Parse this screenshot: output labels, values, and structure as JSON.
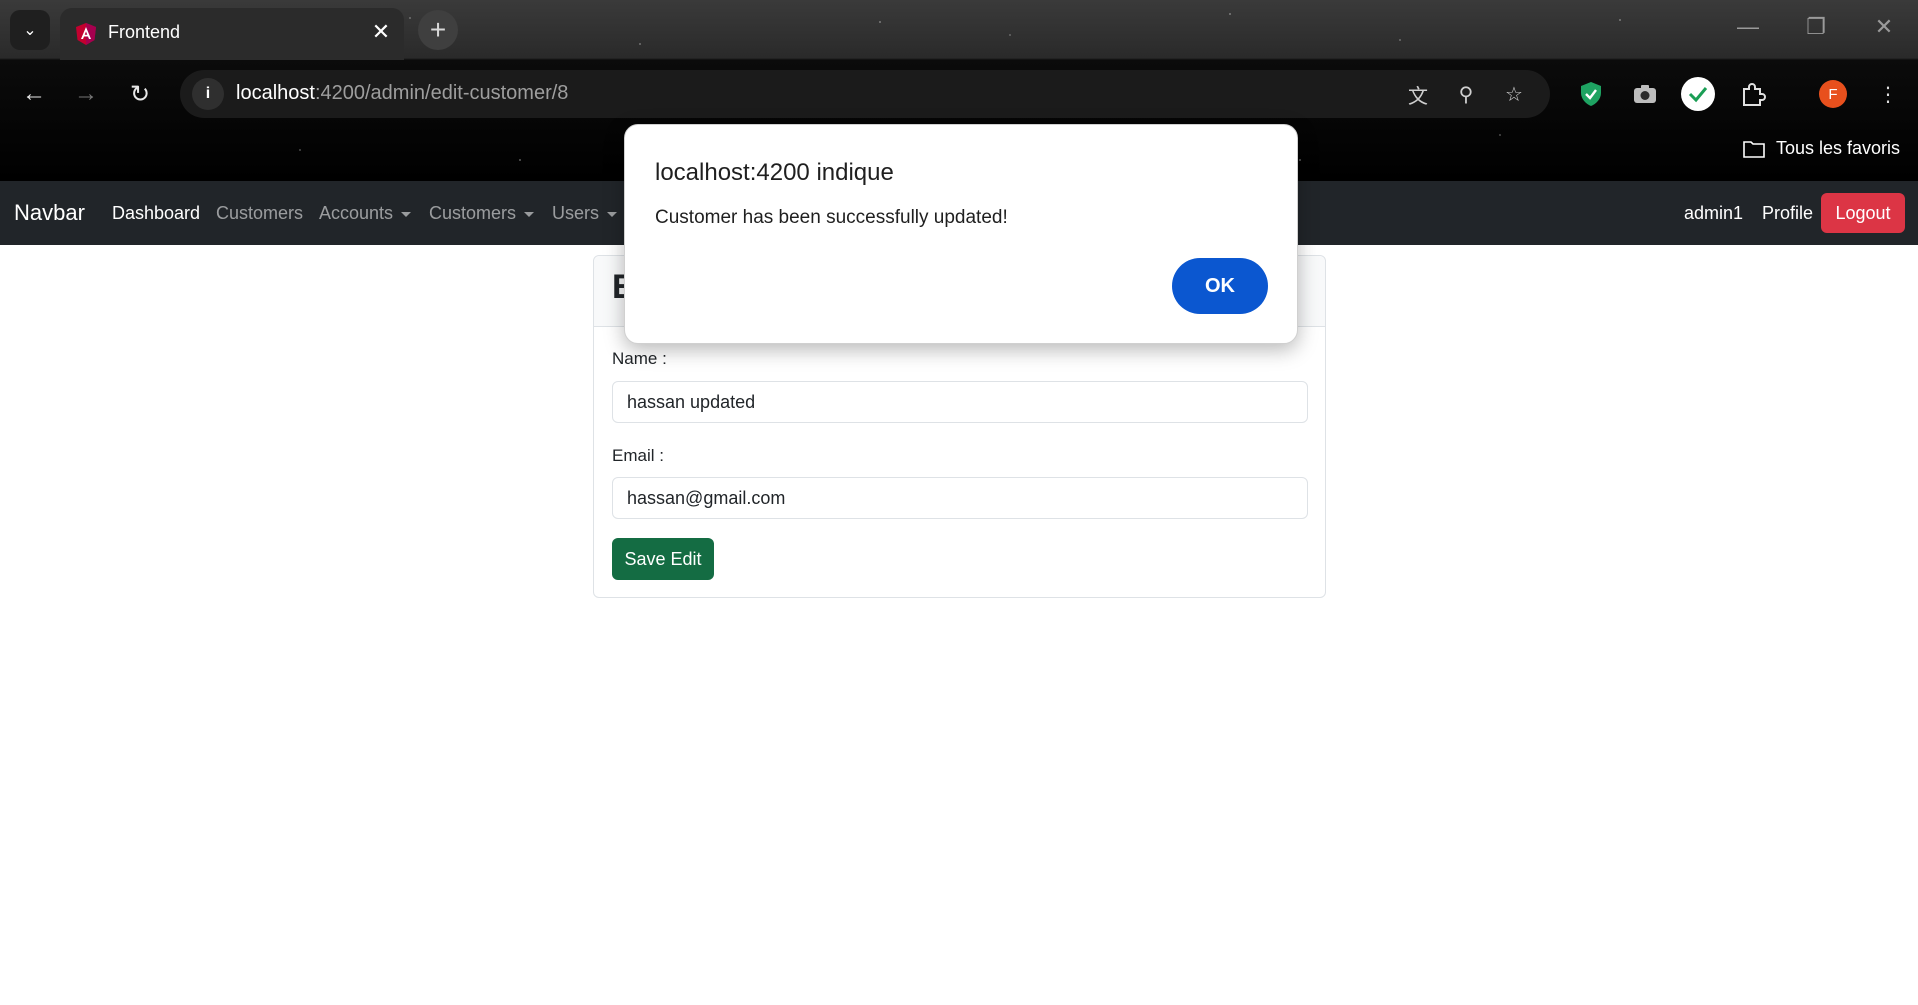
{
  "browser": {
    "tab": {
      "title": "Frontend",
      "favicon": "angular-logo-icon"
    },
    "url": {
      "host": "localhost",
      "path": ":4200/admin/edit-customer/8"
    },
    "bookmarks": {
      "all_label": "Tous les favoris"
    },
    "profile_initial": "F"
  },
  "navbar": {
    "brand": "Navbar",
    "links": {
      "dashboard": "Dashboard",
      "customers": "Customers",
      "accounts": "Accounts",
      "customers_menu": "Customers",
      "users": "Users"
    },
    "user": "admin1",
    "profile": "Profile",
    "logout": "Logout"
  },
  "form": {
    "title_partial": "E",
    "name_label": "Name :",
    "name_value": "hassan updated",
    "email_label": "Email :",
    "email_value": "hassan@gmail.com",
    "save_label": "Save Edit"
  },
  "dialog": {
    "title": "localhost:4200 indique",
    "message": "Customer has been successfully updated!",
    "ok_label": "OK"
  },
  "colors": {
    "logout": "#dc3545",
    "save": "#146c43",
    "dialog_ok": "#0b57d0",
    "navbar": "#212529"
  }
}
